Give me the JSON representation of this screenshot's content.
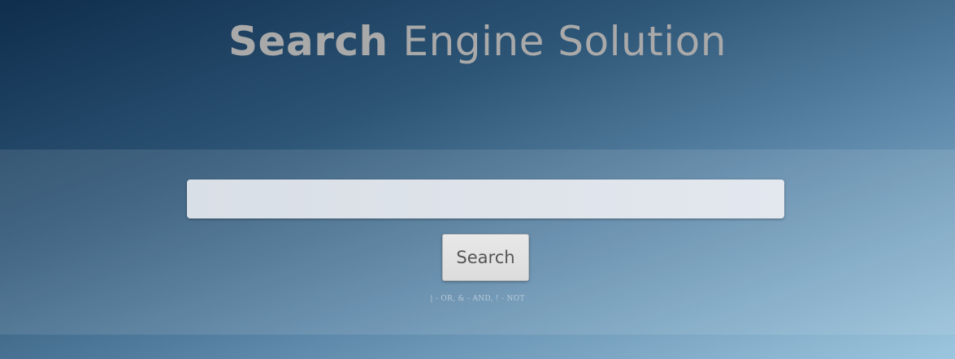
{
  "header": {
    "title_bold": "Search",
    "title_light": "Engine Solution"
  },
  "search": {
    "value": "",
    "placeholder": "",
    "button_label": "Search",
    "hint": "| - OR, & - AND, ! - NOT"
  },
  "colors": {
    "background_top": "#0f2d4c",
    "background_bottom": "#9cc6de",
    "title_text": "#a9a9a9",
    "input_background": "#dde2e9",
    "button_background": "#e2e2e2"
  }
}
